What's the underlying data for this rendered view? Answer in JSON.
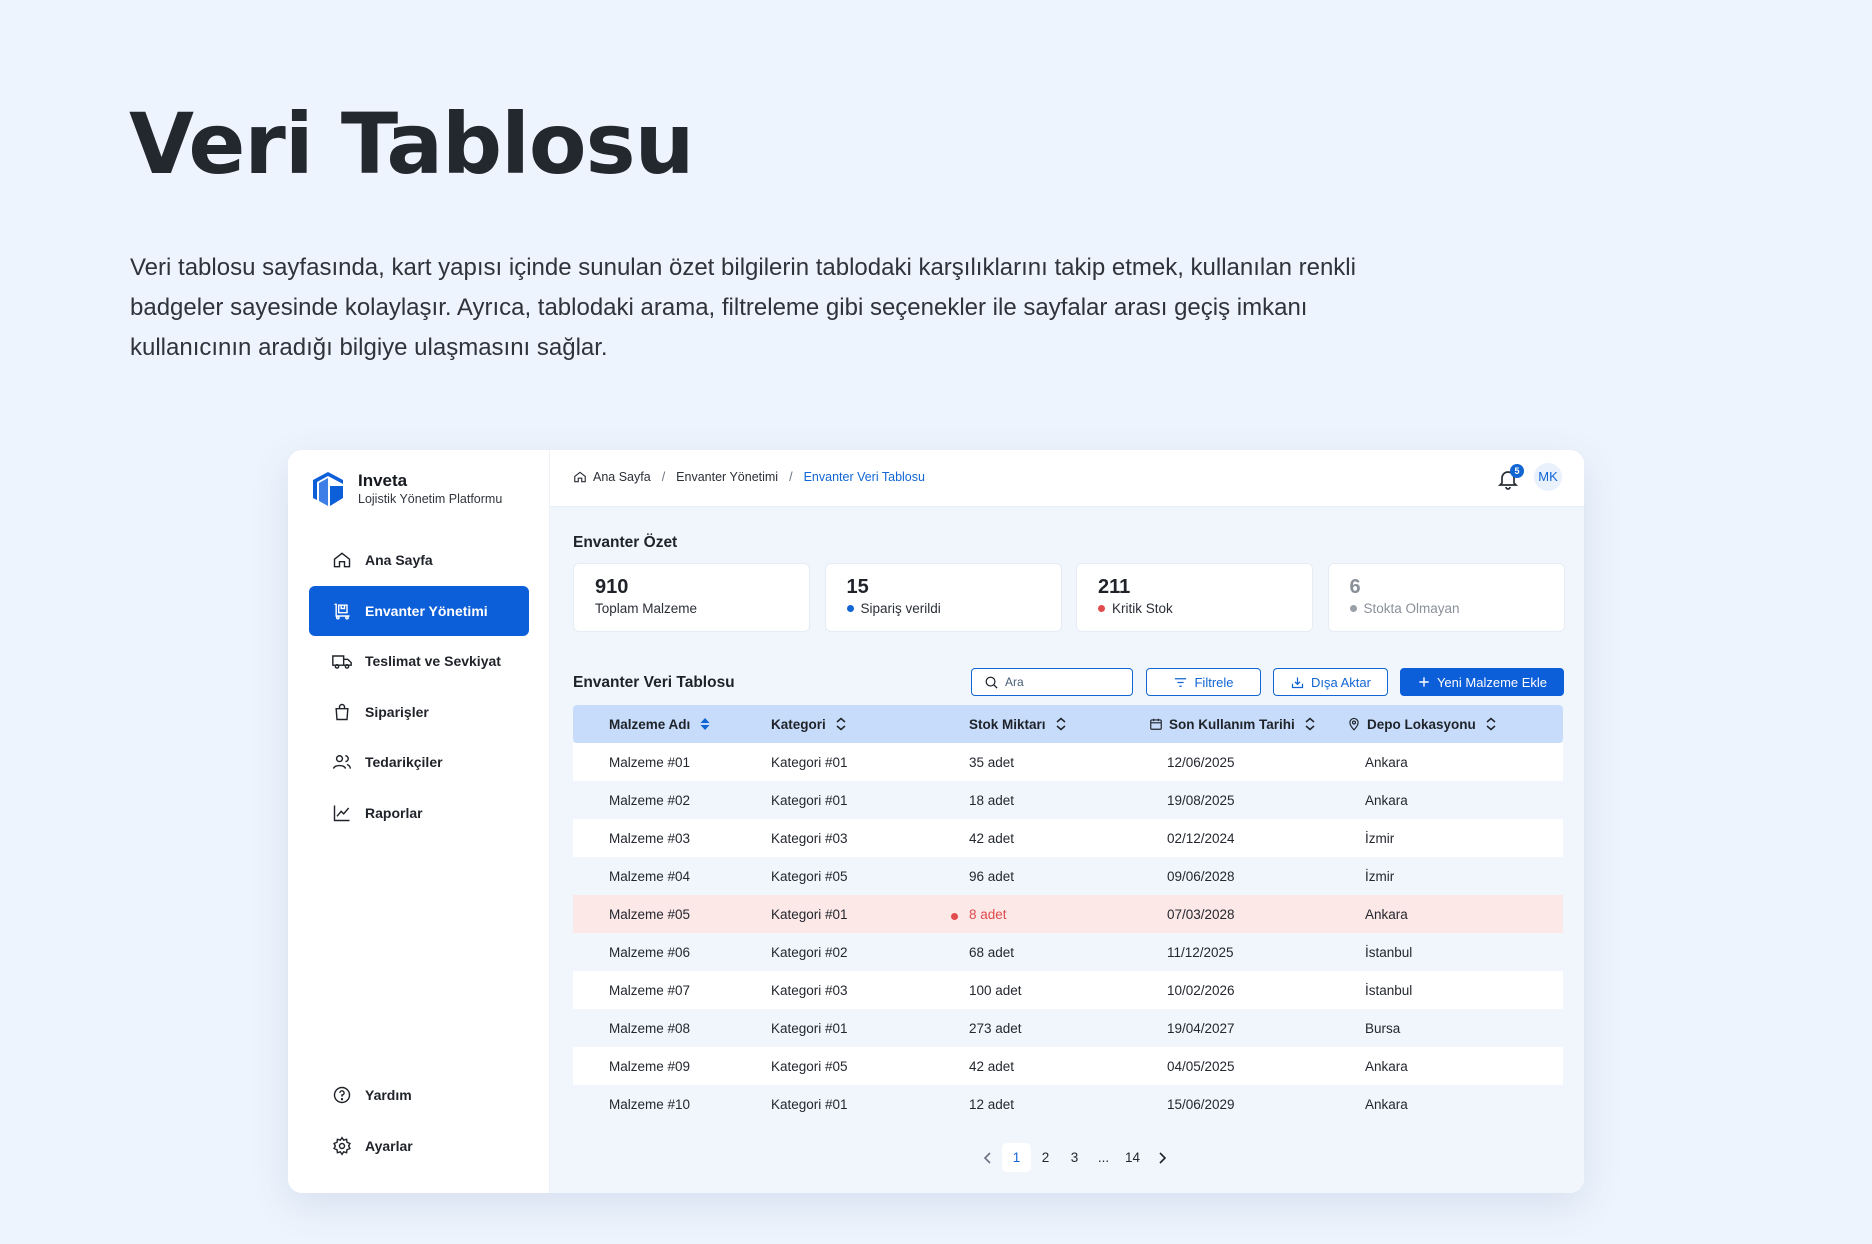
{
  "hero": {
    "title": "Veri Tablosu",
    "description": "Veri tablosu sayfasında, kart yapısı içinde sunulan özet bilgilerin tablodaki karşılıklarını takip etmek, kullanılan renkli badgeler sayesinde kolaylaşır. Ayrıca, tablodaki arama, filtreleme gibi seçenekler ile sayfalar arası geçiş imkanı kullanıcının aradığı bilgiye ulaşmasını sağlar."
  },
  "brand": {
    "name": "Inveta",
    "subtitle": "Lojistik Yönetim Platformu",
    "color": "#0d5ed9"
  },
  "sidebar": {
    "items": [
      {
        "label": "Ana Sayfa",
        "icon": "home-icon"
      },
      {
        "label": "Envanter Yönetimi",
        "icon": "inventory-icon",
        "active": true
      },
      {
        "label": "Teslimat ve Sevkiyat",
        "icon": "truck-icon"
      },
      {
        "label": "Siparişler",
        "icon": "bag-icon"
      },
      {
        "label": "Tedarikçiler",
        "icon": "users-icon"
      },
      {
        "label": "Raporlar",
        "icon": "chart-icon"
      }
    ],
    "bottom": [
      {
        "label": "Yardım",
        "icon": "help-icon"
      },
      {
        "label": "Ayarlar",
        "icon": "gear-icon"
      }
    ]
  },
  "breadcrumb": [
    "Ana Sayfa",
    "Envanter Yönetimi",
    "Envanter Veri Tablosu"
  ],
  "header": {
    "notification_count": "5",
    "user_initials": "MK"
  },
  "summary": {
    "title": "Envanter Özet",
    "cards": [
      {
        "value": "910",
        "label": "Toplam Malzeme"
      },
      {
        "value": "15",
        "label": "Sipariş verildi",
        "dot_color": "#1266d4"
      },
      {
        "value": "211",
        "label": "Kritik Stok",
        "dot_color": "#e14b4b"
      },
      {
        "value": "6",
        "label": "Stokta Olmayan",
        "dot_color": "#9aa0a8"
      }
    ]
  },
  "table": {
    "title": "Envanter Veri Tablosu",
    "search_placeholder": "Ara",
    "filter_label": "Filtrele",
    "export_label": "Dışa Aktar",
    "add_label": "Yeni Malzeme Ekle",
    "columns": [
      "Malzeme Adı",
      "Kategori",
      "Stok Miktarı",
      "Son Kullanım Tarihi",
      "Depo Lokasyonu"
    ],
    "rows": [
      [
        "Malzeme #01",
        "Kategori #01",
        "35 adet",
        "12/06/2025",
        "Ankara"
      ],
      [
        "Malzeme #02",
        "Kategori #01",
        "18 adet",
        "19/08/2025",
        "Ankara"
      ],
      [
        "Malzeme #03",
        "Kategori #03",
        "42 adet",
        "02/12/2024",
        "İzmir"
      ],
      [
        "Malzeme #04",
        "Kategori #05",
        "96 adet",
        "09/06/2028",
        "İzmir"
      ],
      [
        "Malzeme #05",
        "Kategori #01",
        "8 adet",
        "07/03/2028",
        "Ankara"
      ],
      [
        "Malzeme #06",
        "Kategori #02",
        "68 adet",
        "11/12/2025",
        "İstanbul"
      ],
      [
        "Malzeme #07",
        "Kategori #03",
        "100 adet",
        "10/02/2026",
        "İstanbul"
      ],
      [
        "Malzeme #08",
        "Kategori #01",
        "273 adet",
        "19/04/2027",
        "Bursa"
      ],
      [
        "Malzeme #09",
        "Kategori #05",
        "42 adet",
        "04/05/2025",
        "Ankara"
      ],
      [
        "Malzeme #10",
        "Kategori #01",
        "12 adet",
        "15/06/2029",
        "Ankara"
      ]
    ],
    "critical_row": 4
  },
  "pagination": {
    "pages": [
      "1",
      "2",
      "3",
      "...",
      "14"
    ],
    "current": "1"
  }
}
